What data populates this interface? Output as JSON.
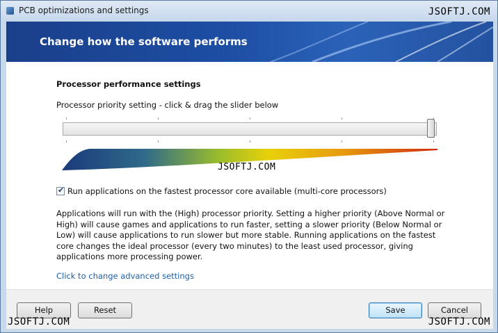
{
  "window": {
    "title": "PCB optimizations and settings"
  },
  "watermark": "JSOFTJ.COM",
  "banner": {
    "title": "Change how the software performs"
  },
  "processor": {
    "section_title": "Processor performance settings",
    "slider_label": "Processor priority setting - click & drag the slider below",
    "slider_value": 1.0,
    "fastest_core_checked": true,
    "fastest_core_label": "Run applications on the fastest processor core available (multi-core processors)",
    "description": "Applications will run with the (High) processor priority.  Setting a higher priority (Above Normal or High) will cause games and applications to run faster, setting a slower priority (Below Normal or Low) will cause applications to run slower but more stable.  Running applications on the fastest core changes the ideal processor (every two minutes) to the least used processor, giving applications more processing power.",
    "advanced_link": "Click to change advanced settings"
  },
  "footer": {
    "help_label": "Help",
    "reset_label": "Reset",
    "save_label": "Save",
    "cancel_label": "Cancel"
  },
  "colors": {
    "banner": "#1c4ea3",
    "link": "#1f5fa9",
    "wedge_start": "#1b3a7a",
    "wedge_mid": "#e8d10a",
    "wedge_end": "#d02a10"
  }
}
